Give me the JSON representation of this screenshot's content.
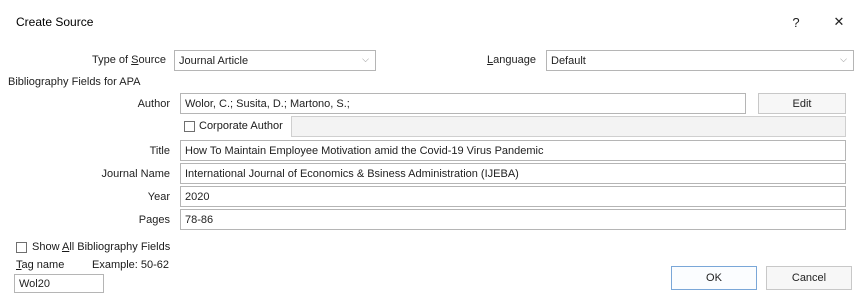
{
  "dialog": {
    "title": "Create Source",
    "help_label": "?",
    "close_label": "✕"
  },
  "type_of_source": {
    "label_pre": "Type of ",
    "label_key": "S",
    "label_post": "ource",
    "value": "Journal Article"
  },
  "language": {
    "label_key": "L",
    "label_post": "anguage",
    "value": "Default"
  },
  "section_label": "Bibliography Fields for APA",
  "fields": {
    "author": {
      "label": "Author",
      "value": "Wolor, C.; Susita, D.; Martono, S.;"
    },
    "corporate_author": {
      "label": "Corporate Author",
      "checked": false,
      "value": ""
    },
    "title": {
      "label": "Title",
      "value": "How To Maintain Employee Motivation amid the Covid-19 Virus Pandemic"
    },
    "journal_name": {
      "label": "Journal Name",
      "value": "International Journal of Economics & Bsiness Administration (IJEBA)"
    },
    "year": {
      "label": "Year",
      "value": "2020"
    },
    "pages": {
      "label": "Pages",
      "value": "78-86"
    }
  },
  "edit_button": "Edit",
  "show_all": {
    "label_pre": "Show ",
    "label_key": "A",
    "label_post": "ll Bibliography Fields",
    "checked": false
  },
  "tag": {
    "label_key": "T",
    "label_post": "ag name",
    "example": "Example: 50-62",
    "value": "Wol20"
  },
  "buttons": {
    "ok": "OK",
    "cancel": "Cancel"
  },
  "icons": {
    "dropdown": "chevron-down-icon"
  }
}
